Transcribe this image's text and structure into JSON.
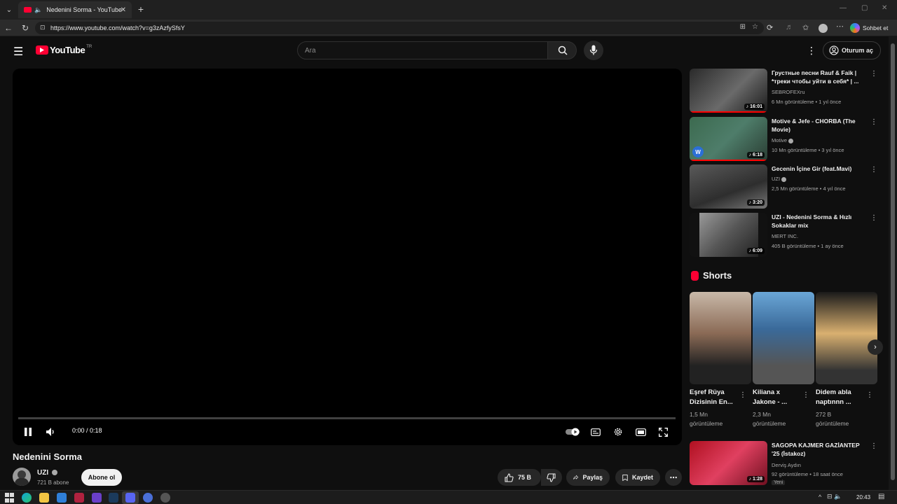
{
  "browser": {
    "tab_title": "Nedenini Sorma - YouTube",
    "url": "https://www.youtube.com/watch?v=g3zAzfySfsY",
    "copilot_label": "Sohbet et"
  },
  "header": {
    "logo_text": "YouTube",
    "region": "TR",
    "search_placeholder": "Ara",
    "signin_label": "Oturum aç"
  },
  "player": {
    "time": "0:00 / 0:18",
    "progress": 0.0
  },
  "video": {
    "title": "Nedenini Sorma",
    "channel": "UZI",
    "subscribers": "721 B abone",
    "subscribe_label": "Abone ol",
    "likes": "75 B",
    "share_label": "Paylaş",
    "save_label": "Kaydet"
  },
  "recommendations": [
    {
      "title": "Грустные песни Rauf & Faik | *треки чтобы уйти в себя* | ...",
      "channel": "SEBROFEXru",
      "meta": "6 Mn görüntüleme • 1 yıl önce",
      "duration": "16:01"
    },
    {
      "title": "Motive & Jefe - CHORBA (The Movie)",
      "channel": "Motive",
      "meta": "10 Mn görüntüleme • 3 yıl önce",
      "duration": "6:18"
    },
    {
      "title": "Gecenin İçine Gir (feat.Mavi)",
      "channel": "UZI",
      "meta": "2,5 Mn görüntüleme • 4 yıl önce",
      "duration": "3:20"
    },
    {
      "title": "UZI - Nedenini Sorma & Hızlı Sokaklar mix",
      "channel": "MERT INC.",
      "meta": "405 B görüntüleme • 1 ay önce",
      "duration": "6:09"
    }
  ],
  "shorts": {
    "heading": "Shorts",
    "items": [
      {
        "title": "Eşref Rüya Dizisinin En...",
        "views1": "1,5 Mn",
        "views2": "görüntüleme"
      },
      {
        "title": "Kiliana x Jakone - ...",
        "views1": "2,3 Mn",
        "views2": "görüntüleme"
      },
      {
        "title": "Didem abla naptınnn ...",
        "views1": "272 B",
        "views2": "görüntüleme"
      }
    ]
  },
  "bottom_rec": {
    "title": "SAGOPA KAJMER GAZİANTEP '25 (İstakoz)",
    "channel": "Derviş Aydın",
    "meta": "92 görüntüleme • 18 saat önce",
    "badge": "Yeni",
    "duration": "1:28"
  },
  "taskbar": {
    "clock": "20:43"
  }
}
